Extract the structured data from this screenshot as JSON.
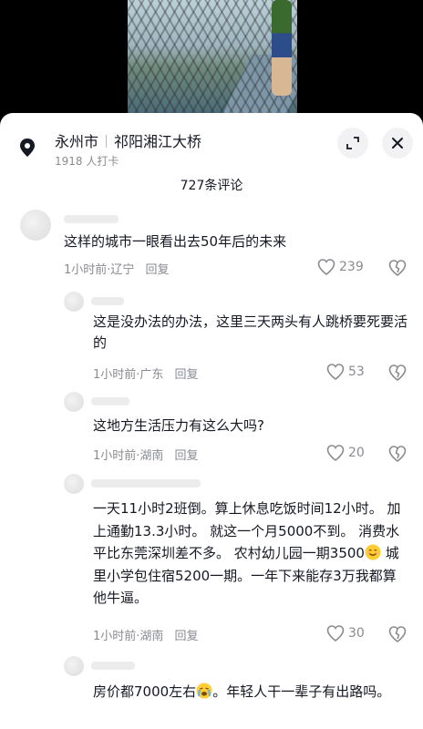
{
  "location": {
    "city": "永州市",
    "place": "祁阳湘江大桥",
    "checkins": "1918 人打卡"
  },
  "comment_count": "727条评论",
  "comments": [
    {
      "text": "这样的城市一眼看出去50年后的未来",
      "time": "1小时前",
      "region": "辽宁",
      "reply": "回复",
      "likes": "239"
    },
    {
      "text": "这是没办法的办法，这里三天两头有人跳桥要死要活的",
      "time": "1小时前",
      "region": "广东",
      "reply": "回复",
      "likes": "53"
    },
    {
      "text": "这地方生活压力有这么大吗?",
      "time": "1小时前",
      "region": "湖南",
      "reply": "回复",
      "likes": "20"
    },
    {
      "text_a": "一天11小时2班倒。算上休息吃饭时间12小时。 加上通勤13.3小时。 就这一个月5000不到。 消费水平比东莞深圳差不多。 农村幼儿园一期3500",
      "emoji_1": "smiling-face",
      "text_b": "  城里小学包住宿5200一期。一年下来能存3万我都算他牛逼。",
      "time": "1小时前",
      "region": "湖南",
      "reply": "回复",
      "likes": "30"
    },
    {
      "text_a": "房价都7000左右",
      "emoji_1": "crying-face",
      "text_b": "。年轻人干一辈子有出路吗。"
    }
  ]
}
